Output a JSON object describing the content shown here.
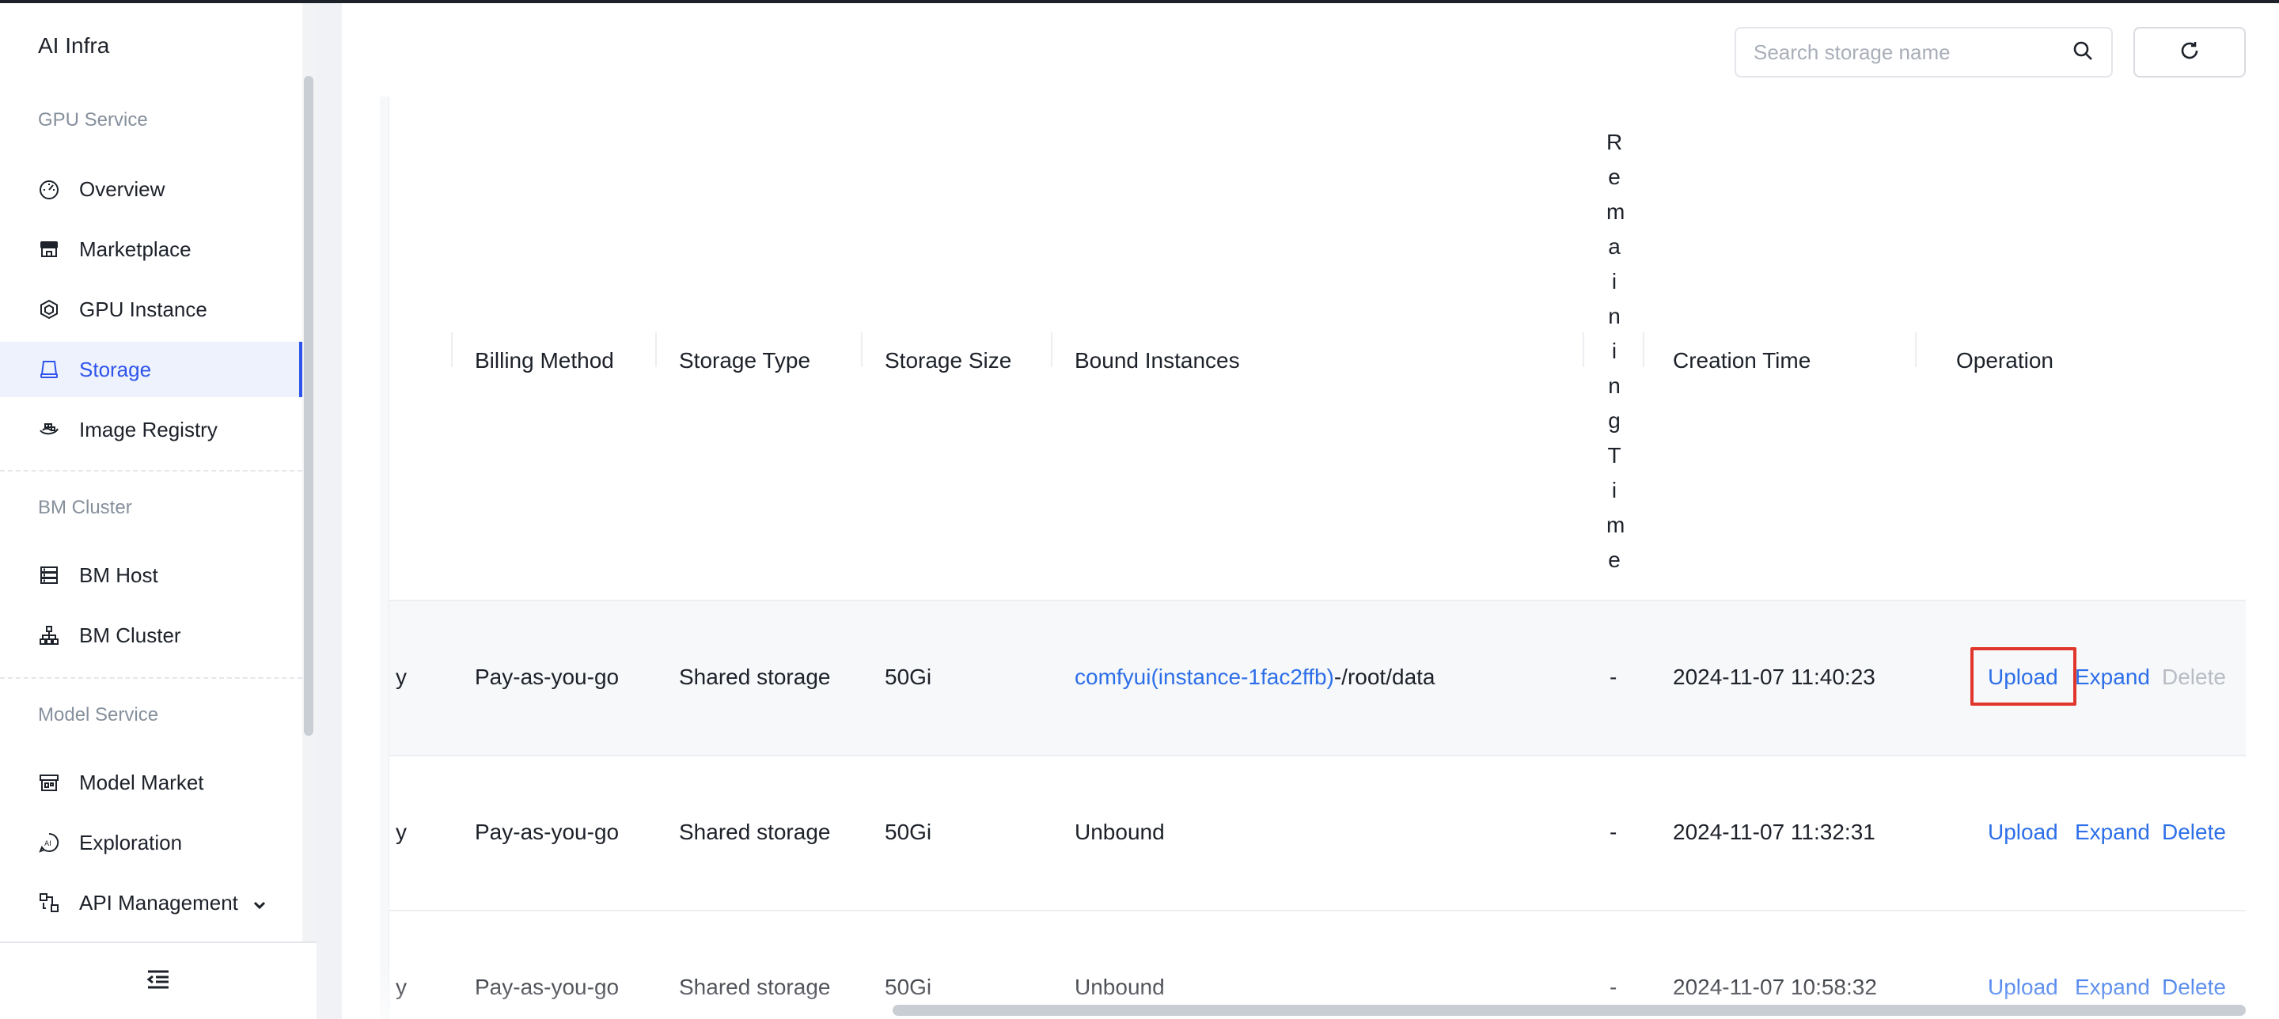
{
  "app": {
    "title": "AI Infra"
  },
  "sidebar": {
    "groups": [
      {
        "label": "GPU Service"
      },
      {
        "label": "BM Cluster"
      },
      {
        "label": "Model Service"
      }
    ],
    "items": [
      {
        "label": "Overview",
        "icon": "dashboard-icon"
      },
      {
        "label": "Marketplace",
        "icon": "store-icon"
      },
      {
        "label": "GPU Instance",
        "icon": "chip-icon"
      },
      {
        "label": "Storage",
        "icon": "disk-icon",
        "active": true
      },
      {
        "label": "Image Registry",
        "icon": "registry-icon"
      },
      {
        "label": "BM Host",
        "icon": "server-icon"
      },
      {
        "label": "BM Cluster",
        "icon": "cluster-icon"
      },
      {
        "label": "Model Market",
        "icon": "model-market-icon"
      },
      {
        "label": "Exploration",
        "icon": "ai-chat-icon"
      },
      {
        "label": "API Management",
        "icon": "api-icon"
      }
    ]
  },
  "search": {
    "placeholder": "Search storage name"
  },
  "table": {
    "columns": {
      "billing": "Billing Method",
      "type": "Storage Type",
      "size": "Storage Size",
      "bound": "Bound Instances",
      "remaining": "RemainingTime",
      "created": "Creation Time",
      "operation": "Operation"
    },
    "rows": [
      {
        "cut": "y",
        "billing": "Pay-as-you-go",
        "type": "Shared storage",
        "size": "50Gi",
        "bound_link": "comfyui(instance-1fac2ffb)",
        "bound_path": "-/root/data",
        "remaining": "-",
        "created": "2024-11-07 11:40:23",
        "ops": {
          "upload": "Upload",
          "expand": "Expand",
          "delete": "Delete"
        }
      },
      {
        "cut": "y",
        "billing": "Pay-as-you-go",
        "type": "Shared storage",
        "size": "50Gi",
        "bound": "Unbound",
        "remaining": "-",
        "created": "2024-11-07 11:32:31",
        "ops": {
          "upload": "Upload",
          "expand": "Expand",
          "delete": "Delete"
        }
      },
      {
        "cut": "y",
        "billing": "Pay-as-you-go",
        "type": "Shared storage",
        "size": "50Gi",
        "bound": "Unbound",
        "remaining": "-",
        "created": "2024-11-07 10:58:32",
        "ops": {
          "upload": "Upload",
          "expand": "Expand",
          "delete": "Delete"
        }
      }
    ]
  },
  "colors": {
    "accent": "#2f54eb",
    "link": "#2d6fe8",
    "highlight_box": "#e0362c"
  }
}
